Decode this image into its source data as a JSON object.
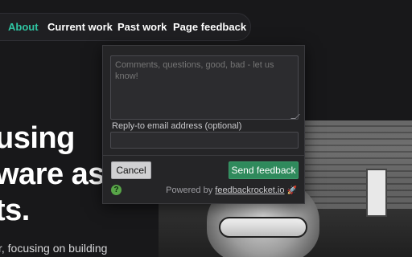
{
  "nav": {
    "items": [
      {
        "label": "About",
        "active": true
      },
      {
        "label": "Current work",
        "active": false
      },
      {
        "label": "Past work",
        "active": false
      },
      {
        "label": "Page feedback",
        "active": false
      }
    ]
  },
  "hero": {
    "line1": "using",
    "line2": "ware as",
    "line3": "ts.",
    "subtitle": "r, focusing on building"
  },
  "feedback": {
    "comment_placeholder": "Comments, questions, good, bad - let us know!",
    "email_label": "Reply-to email address (optional)",
    "email_value": "",
    "cancel_label": "Cancel",
    "send_label": "Send feedback",
    "help_symbol": "?",
    "powered_prefix": "Powered by ",
    "powered_link": "feedbackrocket.io",
    "rocket_glyph": "🚀"
  },
  "colors": {
    "accent": "#2fc4a2",
    "send_button": "#2f8a5c",
    "background": "#18181a"
  }
}
